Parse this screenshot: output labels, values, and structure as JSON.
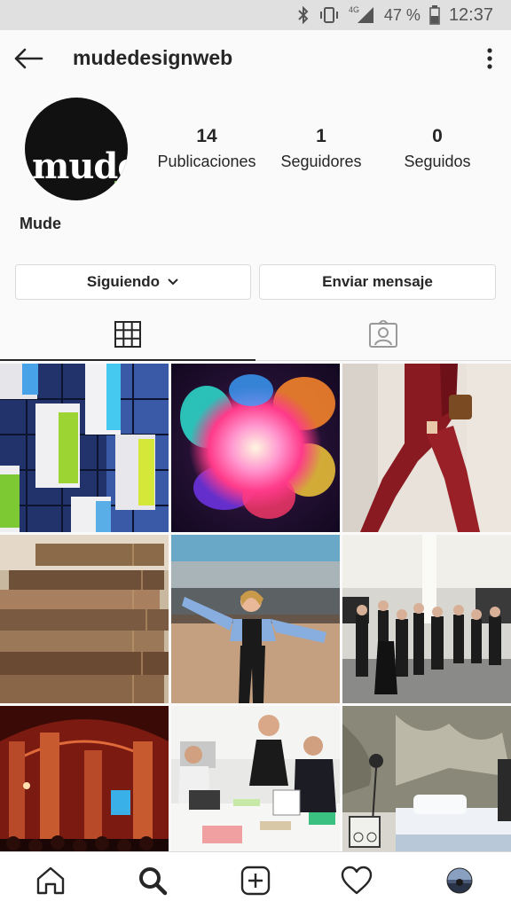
{
  "status_bar": {
    "network": "4G",
    "battery": "47 %",
    "time": "12:37",
    "icons": [
      "bluetooth-icon",
      "vibrate-icon",
      "signal-icon",
      "battery-icon"
    ]
  },
  "header": {
    "username": "mudedesignweb",
    "icons": [
      "back-arrow-icon",
      "more-options-icon"
    ]
  },
  "profile": {
    "avatar_text": "mude",
    "display_name": "Mude",
    "stats": [
      {
        "value": "14",
        "label": "Publicaciones"
      },
      {
        "value": "1",
        "label": "Seguidores"
      },
      {
        "value": "0",
        "label": "Seguidos"
      }
    ]
  },
  "actions": {
    "following_label": "Siguiendo",
    "message_label": "Enviar mensaje"
  },
  "tabs": [
    {
      "icon": "grid-icon",
      "active": true
    },
    {
      "icon": "tagged-photos-icon",
      "active": false
    }
  ],
  "posts": [
    {
      "subject": "colorful building facade"
    },
    {
      "subject": "color powder explosion"
    },
    {
      "subject": "red suit fashion"
    },
    {
      "subject": "old books stack"
    },
    {
      "subject": "woman in denim jacket"
    },
    {
      "subject": "fashion show event"
    },
    {
      "subject": "red lit hall event"
    },
    {
      "subject": "design meeting at table"
    },
    {
      "subject": "bedroom with textured wall"
    }
  ],
  "bottom_nav": [
    "home-icon",
    "search-icon",
    "new-post-icon",
    "activity-heart-icon",
    "profile-avatar-icon"
  ],
  "colors": {
    "background": "#fafafa",
    "text": "#262626",
    "border": "#dbdbdb",
    "status_bar": "#e0e0e0"
  }
}
